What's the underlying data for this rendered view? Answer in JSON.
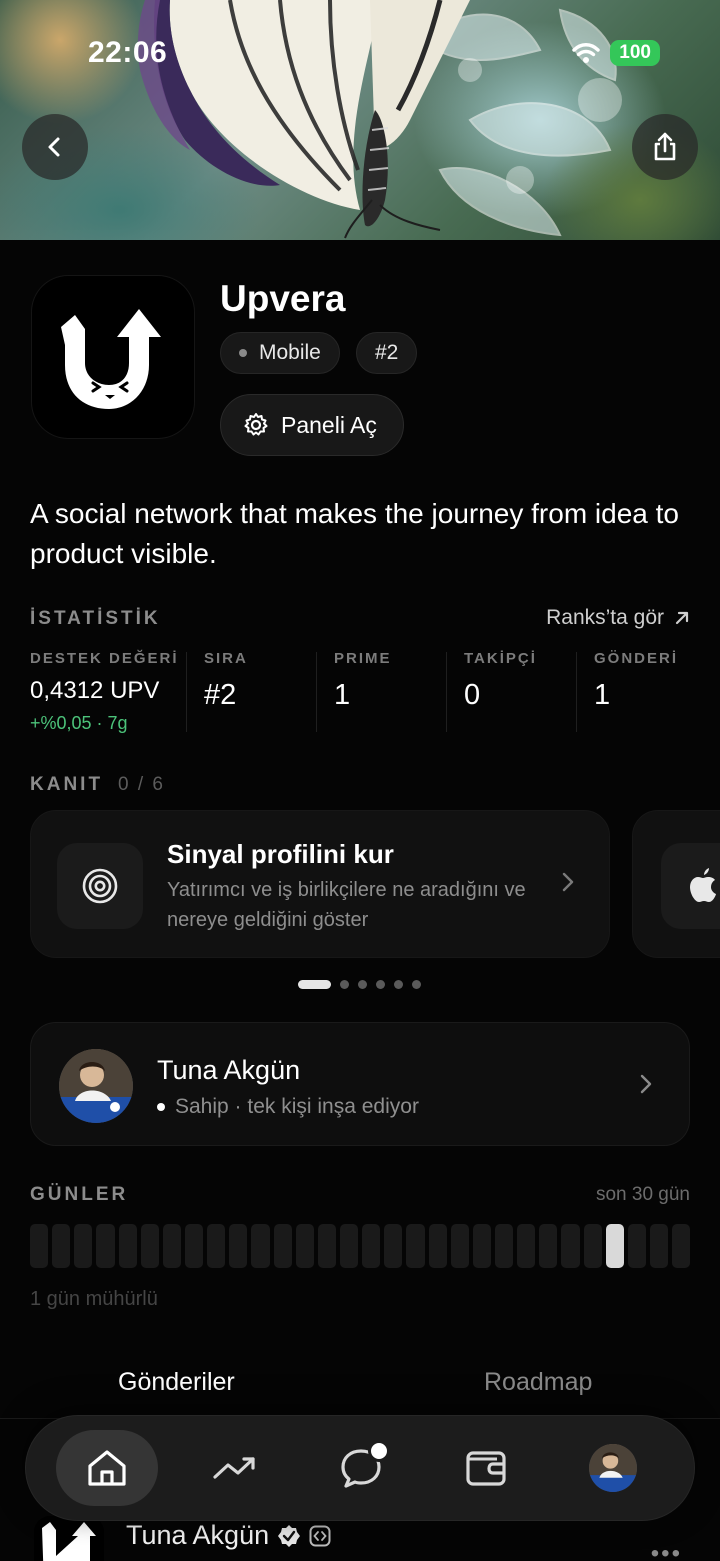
{
  "status_bar": {
    "time": "22:06",
    "battery": "100"
  },
  "app": {
    "name": "Upvera",
    "platform": "Mobile",
    "rank_badge": "#2",
    "panel_button": "Paneli Aç",
    "tagline": "A social network that makes the journey from idea to product visible."
  },
  "stats": {
    "title": "İSTATİSTİK",
    "ranks_link": "Ranks’ta gör",
    "items": [
      {
        "label": "DESTEK DEĞERİ",
        "value": "0,4312 UPV",
        "change": "+%0,05 · 7g"
      },
      {
        "label": "SIRA",
        "value": "#2"
      },
      {
        "label": "PRIME",
        "value": "1"
      },
      {
        "label": "TAKİPÇİ",
        "value": "0"
      },
      {
        "label": "GÖNDERİ",
        "value": "1"
      }
    ]
  },
  "proof": {
    "title": "KANIT",
    "count": "0 / 6",
    "cards": [
      {
        "icon": "target-icon",
        "title": "Sinyal profilini kur",
        "description": "Yatırımcı ve iş birlikçilere ne aradığını ve nereye geldiğini göster"
      },
      {
        "icon": "apple-icon"
      }
    ],
    "pager": {
      "total": 6,
      "active": 0
    }
  },
  "owner": {
    "name": "Tuna Akgün",
    "role": "Sahip · tek kişi inşa ediyor"
  },
  "days": {
    "title": "GÜNLER",
    "range": "son 30 gün",
    "sealed": "1 gün mühürlü",
    "total": 30,
    "sealed_index": 26
  },
  "tabs": [
    {
      "label": "Gönderiler",
      "active": true
    },
    {
      "label": "Roadmap",
      "active": false
    }
  ],
  "feed_preview": {
    "author": "Tuna Akgün",
    "more": "•••"
  },
  "nav": {
    "items": [
      "home-icon",
      "trending-icon",
      "chat-icon",
      "wallet-icon",
      "profile-avatar"
    ],
    "active": "home-icon"
  },
  "colors": {
    "accent_green": "#4cc37a",
    "battery_green": "#34c759",
    "background": "#050505"
  }
}
